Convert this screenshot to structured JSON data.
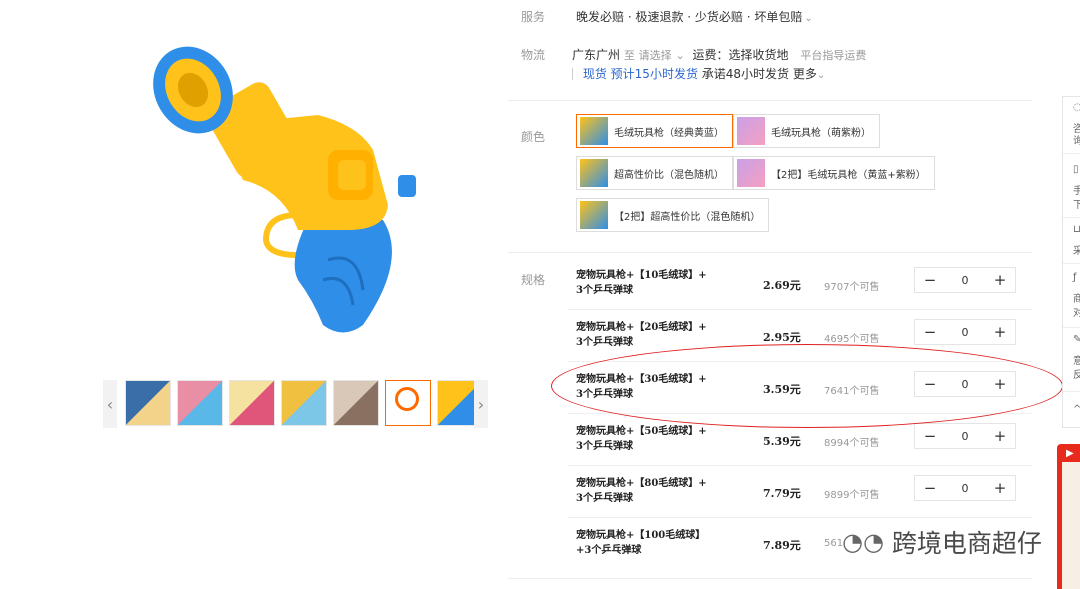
{
  "labels": {
    "service": "服务",
    "logistics": "物流",
    "color": "颜色",
    "spec": "规格"
  },
  "service_text": "晚发必赔 · 极速退款 · 少货必赔 · 坏单包赔",
  "logistics": {
    "from": "广东广州",
    "to_prefix": "至",
    "to_placeholder": "请选择",
    "fee": "运费：选择收货地",
    "guide": "平台指导运费",
    "instock": "现货",
    "estimate": "预计15小时发货",
    "promise": "承诺48小时发货",
    "more": "更多"
  },
  "colors": [
    {
      "label": "毛绒玩具枪（经典黄蓝）",
      "selected": true
    },
    {
      "label": "毛绒玩具枪（萌紫粉）",
      "selected": false
    },
    {
      "label": "超高性价比（混色随机）",
      "selected": false
    },
    {
      "label": "【2把】毛绒玩具枪（黄蓝+紫粉）",
      "selected": false
    },
    {
      "label": "【2把】超高性价比（混色随机）",
      "selected": false
    }
  ],
  "specs": [
    {
      "name_line1": "宠物玩具枪+【10毛绒球】+",
      "name_line2": "3个乒乓弹球",
      "price": "2.69元",
      "stock": "9707个可售",
      "qty": "0"
    },
    {
      "name_line1": "宠物玩具枪+【20毛绒球】+",
      "name_line2": "3个乒乓弹球",
      "price": "2.95元",
      "stock": "4695个可售",
      "qty": "0"
    },
    {
      "name_line1": "宠物玩具枪+【30毛绒球】+",
      "name_line2": "3个乒乓弹球",
      "price": "3.59元",
      "stock": "7641个可售",
      "qty": "0"
    },
    {
      "name_line1": "宠物玩具枪+【50毛绒球】+",
      "name_line2": "3个乒乓弹球",
      "price": "5.39元",
      "stock": "8994个可售",
      "qty": "0"
    },
    {
      "name_line1": "宠物玩具枪+【80毛绒球】+",
      "name_line2": "3个乒乓弹球",
      "price": "7.79元",
      "stock": "9899个可售",
      "qty": "0"
    },
    {
      "name_line1": "宠物玩具枪+【100毛绒球】",
      "name_line2": "+3个乒乓弹球",
      "price": "7.89元",
      "stock": "561",
      "qty": ""
    }
  ],
  "stepper": {
    "minus": "−",
    "plus": "+"
  },
  "thumb_count": 7,
  "right_toolbar": [
    "咨",
    "询",
    "手",
    "下",
    "采",
    "商",
    "对",
    "意",
    "反"
  ],
  "watermark": "跨境电商超仔",
  "colors_theme": {
    "accent": "#ff6a00",
    "highlight": "#e02020",
    "link": "#2a67d1",
    "toy_yellow": "#ffc21a",
    "toy_blue": "#2f8ee8"
  }
}
